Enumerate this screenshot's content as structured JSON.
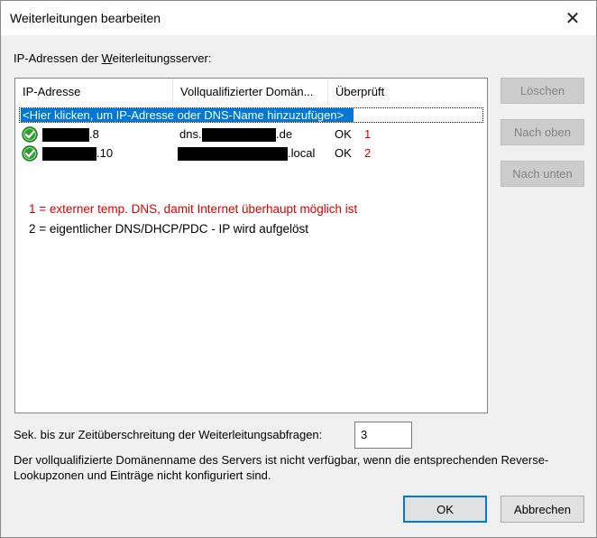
{
  "window": {
    "title": "Weiterleitungen bearbeiten",
    "close_glyph": "✕"
  },
  "section_label_prefix": "IP-Adressen der ",
  "section_label_ul": "W",
  "section_label_suffix": "eiterleitungsserver:",
  "table": {
    "columns": [
      "IP-Adresse",
      "Vollqualifizierter Domän...",
      "Überprüft"
    ],
    "add_row_text": "<Hier klicken, um IP-Adresse oder DNS-Name hinzuzufügen>",
    "rows": [
      {
        "icon": "ok-check-icon",
        "ip_suffix": ".8",
        "fqdn_prefix": "dns.",
        "fqdn_suffix": ".de",
        "status": "OK",
        "marker": "1"
      },
      {
        "icon": "ok-check-icon",
        "ip_suffix": ".10",
        "fqdn_prefix": "",
        "fqdn_suffix": ".local",
        "status": "OK",
        "marker": "2"
      }
    ]
  },
  "annotations": [
    "1 = externer temp. DNS, damit Internet überhaupt möglich ist",
    "2 = eigentlicher DNS/DHCP/PDC - IP wird aufgelöst"
  ],
  "side_buttons": {
    "delete": "Löschen",
    "move_up": "Nach oben",
    "move_down": "Nach unten"
  },
  "timeout": {
    "label": "Sek. bis zur Zeitüberschreitung der Weiterleitungsabfragen:",
    "value": "3"
  },
  "info_text": "Der vollqualifizierte Domänenname des Servers ist nicht verfügbar, wenn die entsprechenden Reverse-Lookupzonen und Einträge nicht konfiguriert sind.",
  "footer": {
    "ok": "OK",
    "cancel": "Abbrechen"
  },
  "colors": {
    "selection": "#0078d7",
    "annotation_red": "#e00000",
    "ok_green": "#2e9e2e"
  }
}
